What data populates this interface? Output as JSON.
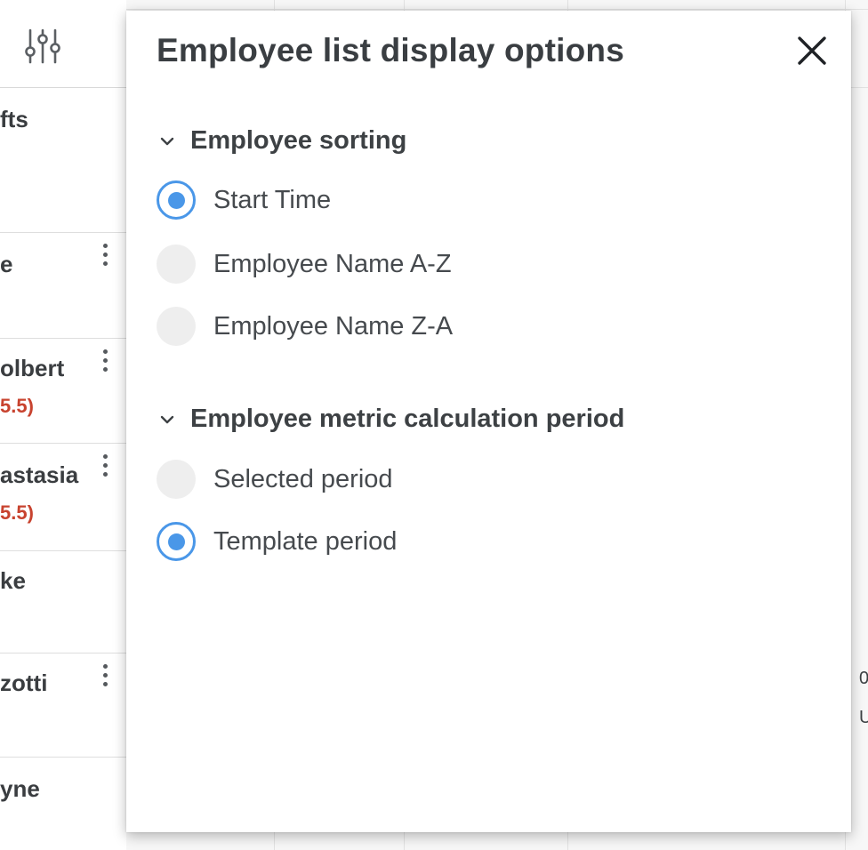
{
  "background": {
    "employees": [
      {
        "name": "fts",
        "metric": null,
        "menu": false
      },
      {
        "name": "e",
        "metric": null,
        "menu": true
      },
      {
        "name": "olbert",
        "metric": "5.5)",
        "menu": true
      },
      {
        "name": "astasia",
        "metric": "5.5)",
        "menu": true
      },
      {
        "name": "ke",
        "metric": null,
        "menu": false
      },
      {
        "name": "zotti",
        "metric": null,
        "menu": true
      },
      {
        "name": "yne",
        "metric": null,
        "menu": false
      }
    ],
    "edge_texts": [
      "0",
      "U"
    ]
  },
  "dialog": {
    "title": "Employee list display options",
    "sections": [
      {
        "title": "Employee sorting",
        "options": [
          {
            "label": "Start Time",
            "checked": true
          },
          {
            "label": "Employee Name A-Z",
            "checked": false
          },
          {
            "label": "Employee Name Z-A",
            "checked": false
          }
        ]
      },
      {
        "title": "Employee metric calculation period",
        "options": [
          {
            "label": "Selected period",
            "checked": false
          },
          {
            "label": "Template period",
            "checked": true
          }
        ]
      }
    ]
  },
  "colors": {
    "accent": "#4a97e8",
    "metric_warning": "#c8432f",
    "text": "#3d4144"
  },
  "icons": {
    "filter": "sliders-icon",
    "close": "close-icon",
    "collapse": "chevron-down-icon",
    "row_menu": "kebab-menu-icon"
  }
}
